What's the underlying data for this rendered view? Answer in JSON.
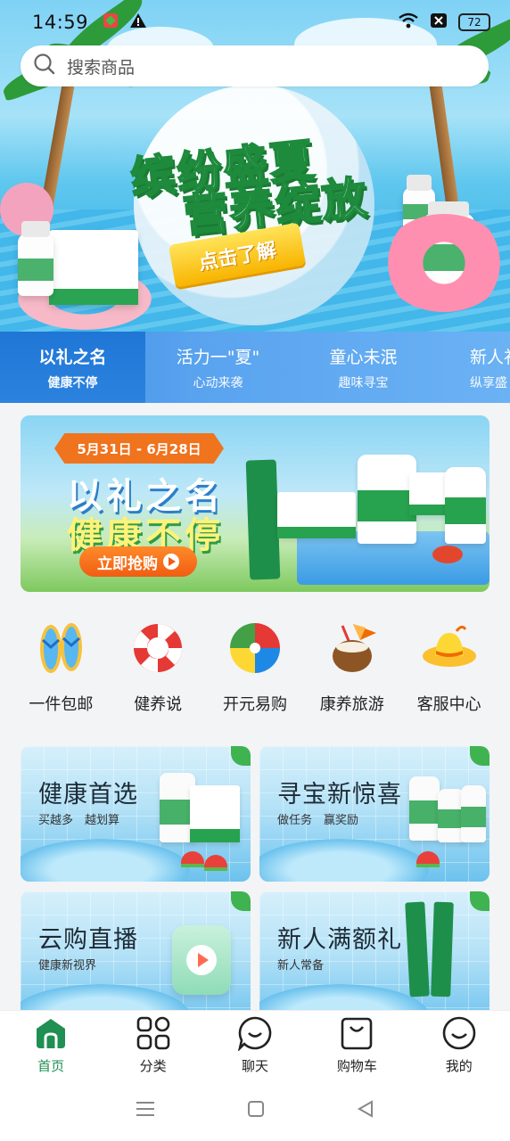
{
  "status_bar": {
    "time": "14:59",
    "battery": "72"
  },
  "search": {
    "placeholder": "搜索商品"
  },
  "hero": {
    "title_line1": "缤纷盛夏",
    "title_line2": "营养绽放",
    "cta": "点击了解"
  },
  "tabs": [
    {
      "title": "以礼之名",
      "subtitle": "健康不停",
      "active": true
    },
    {
      "title": "活力一\"夏\"",
      "subtitle": "心动来袭",
      "active": false
    },
    {
      "title": "童心未泯",
      "subtitle": "趣味寻宝",
      "active": false
    },
    {
      "title": "新人礼",
      "subtitle": "纵享盛",
      "active": false
    }
  ],
  "promo": {
    "date_range": "5月31日 - 6月28日",
    "line1": "以礼之名",
    "line2": "健康不停",
    "button": "立即抢购"
  },
  "quick_icons": [
    {
      "label": "一件包邮",
      "icon": "flip-flops-icon"
    },
    {
      "label": "健养说",
      "icon": "life-ring-icon"
    },
    {
      "label": "开元易购",
      "icon": "beach-ball-icon"
    },
    {
      "label": "康养旅游",
      "icon": "coconut-drink-icon"
    },
    {
      "label": "客服中心",
      "icon": "sun-hat-icon"
    }
  ],
  "cards": [
    {
      "title": "健康首选",
      "subtitle": "买越多　越划算"
    },
    {
      "title": "寻宝新惊喜",
      "subtitle": "做任务　赢奖励"
    },
    {
      "title": "云购直播",
      "subtitle": "健康新视界"
    },
    {
      "title": "新人满额礼",
      "subtitle": "新人常备"
    }
  ],
  "bottom_nav": [
    {
      "label": "首页",
      "icon": "home-icon",
      "active": true
    },
    {
      "label": "分类",
      "icon": "grid-icon",
      "active": false
    },
    {
      "label": "聊天",
      "icon": "chat-icon",
      "active": false
    },
    {
      "label": "购物车",
      "icon": "bag-icon",
      "active": false
    },
    {
      "label": "我的",
      "icon": "profile-smile-icon",
      "active": false
    }
  ],
  "colors": {
    "accent_green": "#1f8f52",
    "tab_blue": "#2c83de",
    "promo_orange": "#f05d12"
  }
}
